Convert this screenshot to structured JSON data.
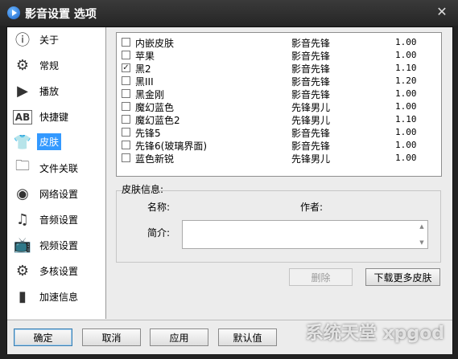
{
  "window": {
    "title": "影音设置 选项",
    "close": "✕"
  },
  "sidebar": {
    "items": [
      {
        "label": "关于",
        "icon": "about-icon",
        "glyph": "ⓘ"
      },
      {
        "label": "常规",
        "icon": "gear-icon",
        "glyph": "⚙"
      },
      {
        "label": "播放",
        "icon": "play-icon",
        "glyph": "▶"
      },
      {
        "label": "快捷键",
        "icon": "keyboard-icon",
        "glyph": "AB"
      },
      {
        "label": "皮肤",
        "icon": "tshirt-icon",
        "glyph": "👕",
        "active": true
      },
      {
        "label": "文件关联",
        "icon": "folder-icon",
        "glyph": "🗀"
      },
      {
        "label": "网络设置",
        "icon": "network-icon",
        "glyph": "◉"
      },
      {
        "label": "音频设置",
        "icon": "audio-icon",
        "glyph": "♫"
      },
      {
        "label": "视频设置",
        "icon": "tv-icon",
        "glyph": "📺"
      },
      {
        "label": "多核设置",
        "icon": "cpu-icon",
        "glyph": "⚙"
      },
      {
        "label": "加速信息",
        "icon": "speed-icon",
        "glyph": "▮"
      }
    ]
  },
  "skins": [
    {
      "name": "内嵌皮肤",
      "author": "影音先锋",
      "version": "1.00",
      "checked": false
    },
    {
      "name": "苹果",
      "author": "影音先锋",
      "version": "1.00",
      "checked": false
    },
    {
      "name": "黑2",
      "author": "影音先锋",
      "version": "1.10",
      "checked": true
    },
    {
      "name": "黑III",
      "author": "影音先锋",
      "version": "1.20",
      "checked": false
    },
    {
      "name": "黑金刚",
      "author": "影音先锋",
      "version": "1.00",
      "checked": false
    },
    {
      "name": "魔幻蓝色",
      "author": "先锋男儿",
      "version": "1.00",
      "checked": false
    },
    {
      "name": "魔幻蓝色2",
      "author": "先锋男儿",
      "version": "1.10",
      "checked": false
    },
    {
      "name": "先锋5",
      "author": "影音先锋",
      "version": "1.00",
      "checked": false
    },
    {
      "name": "先锋6(玻璃界面)",
      "author": "影音先锋",
      "version": "1.00",
      "checked": false
    },
    {
      "name": "蓝色新锐",
      "author": "先锋男儿",
      "version": "1.00",
      "checked": false
    }
  ],
  "info": {
    "title": "皮肤信息:",
    "name_label": "名称:",
    "author_label": "作者:",
    "desc_label": "简介:"
  },
  "actions": {
    "delete": "删除",
    "download": "下载更多皮肤"
  },
  "footer": {
    "ok": "确定",
    "cancel": "取消",
    "apply": "应用",
    "default": "默认值"
  },
  "watermark": "系统天堂 xpgod",
  "colors": {
    "active_bg": "#3399ff"
  }
}
